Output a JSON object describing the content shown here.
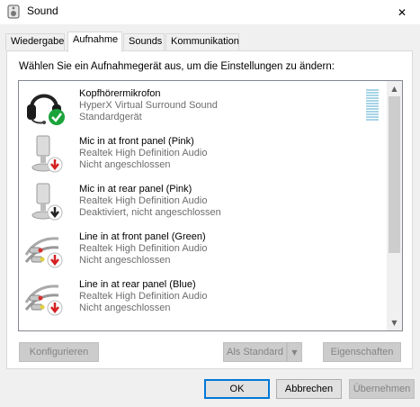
{
  "window": {
    "title": "Sound",
    "close_glyph": "✕"
  },
  "tabs": [
    {
      "label": "Wiedergabe",
      "active": false
    },
    {
      "label": "Aufnahme",
      "active": true
    },
    {
      "label": "Sounds",
      "active": false
    },
    {
      "label": "Kommunikation",
      "active": false
    }
  ],
  "instruction": "Wählen Sie ein Aufnahmegerät aus, um die Einstellungen zu ändern:",
  "devices": [
    {
      "name": "Kopfhörermikrofon",
      "driver": "HyperX Virtual Surround Sound",
      "status": "Standardgerät",
      "icon": "headset-icon",
      "badge": "default-check-icon",
      "badge_color": "#1aa33a"
    },
    {
      "name": "Mic in at front panel (Pink)",
      "driver": "Realtek High Definition Audio",
      "status": "Nicht angeschlossen",
      "icon": "microphone-icon",
      "badge": "unplugged-arrow-icon",
      "badge_color": "#d42020"
    },
    {
      "name": "Mic in at rear panel (Pink)",
      "driver": "Realtek High Definition Audio",
      "status": "Deaktiviert, nicht angeschlossen",
      "icon": "microphone-icon",
      "badge": "disabled-arrow-icon",
      "badge_color": "#222222"
    },
    {
      "name": "Line in at front panel (Green)",
      "driver": "Realtek High Definition Audio",
      "status": "Nicht angeschlossen",
      "icon": "rca-cable-icon",
      "badge": "unplugged-arrow-icon",
      "badge_color": "#d42020"
    },
    {
      "name": "Line in at rear panel (Blue)",
      "driver": "Realtek High Definition Audio",
      "status": "Nicht angeschlossen",
      "icon": "rca-cable-icon",
      "badge": "unplugged-arrow-icon",
      "badge_color": "#d42020"
    }
  ],
  "panel_buttons": {
    "configure": "Konfigurieren",
    "set_default": "Als Standard",
    "properties": "Eigenschaften"
  },
  "dialog_buttons": {
    "ok": "OK",
    "cancel": "Abbrechen",
    "apply": "Übernehmen"
  },
  "colors": {
    "accent": "#0078d7",
    "level_meter": "#a7d4e7"
  }
}
